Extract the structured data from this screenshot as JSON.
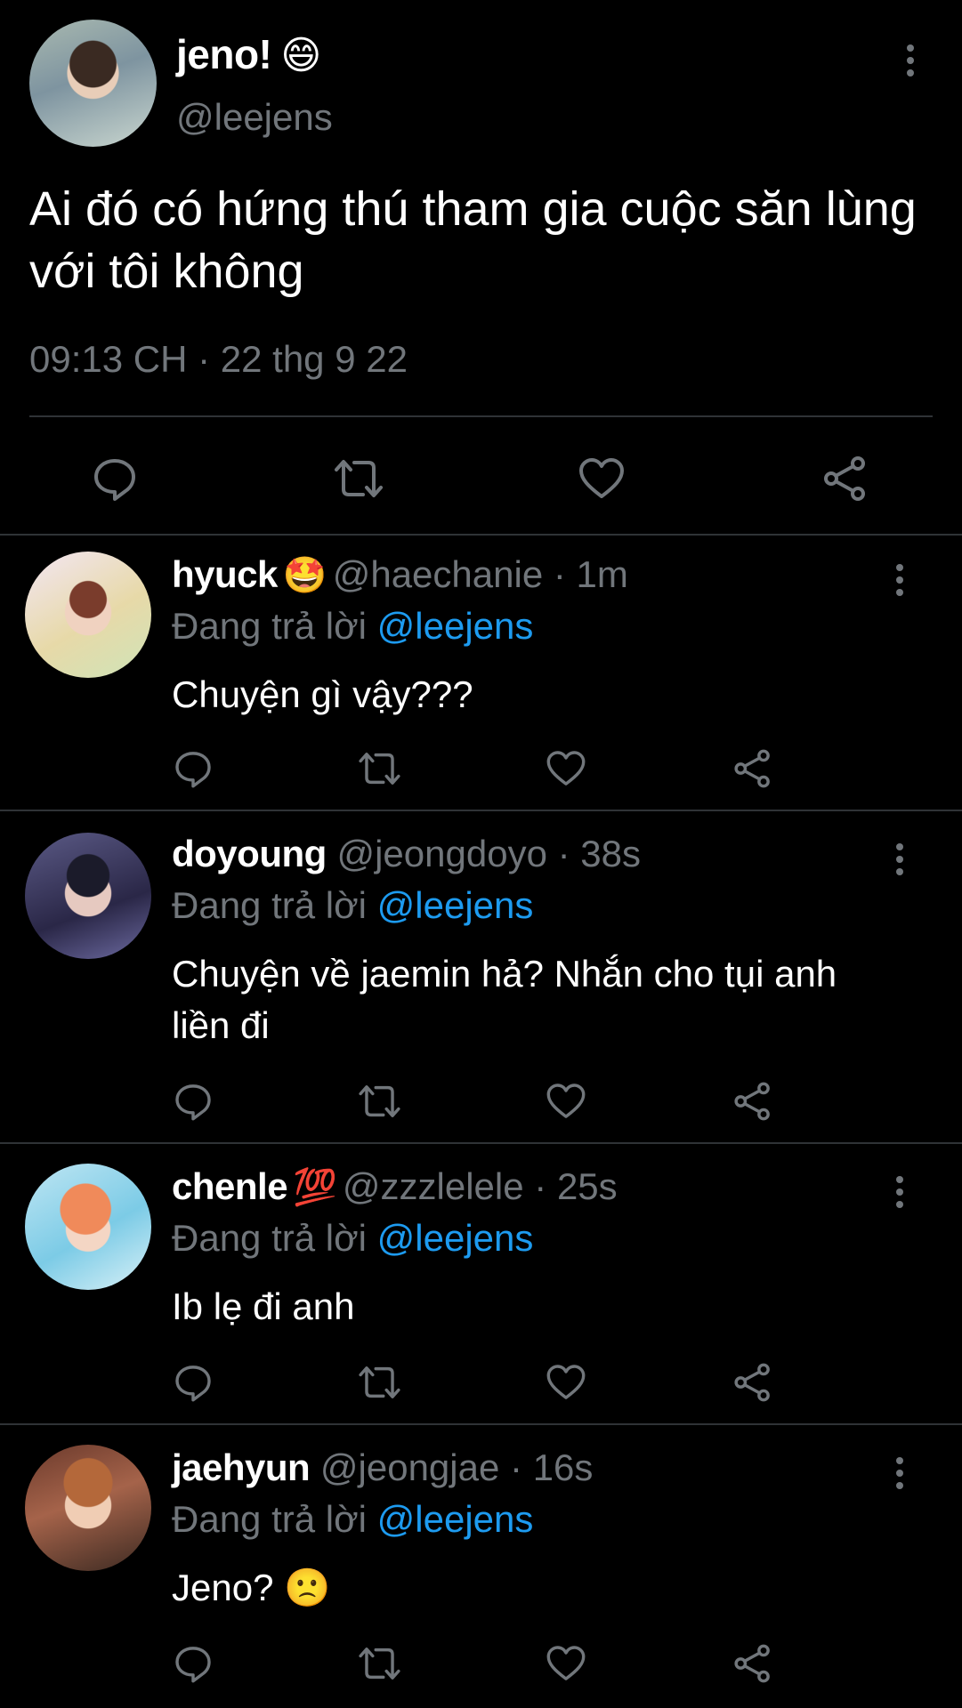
{
  "main_tweet": {
    "name": "jeno!",
    "emoji": "😄",
    "handle": "@leejens",
    "text": "Ai đó có hứng thú tham gia cuộc săn lùng với tôi không",
    "timestamp": "09:13 CH · 22 thg 9 22"
  },
  "replies": [
    {
      "name": "hyuck",
      "emoji": "🤩",
      "handle": "@haechanie",
      "dot": "·",
      "time": "1m",
      "replying_prefix": "Đang trả lời",
      "mention": "@leejens",
      "text": "Chuyện gì vậy???"
    },
    {
      "name": "doyoung",
      "emoji": "",
      "handle": "@jeongdoyo",
      "dot": "·",
      "time": "38s",
      "replying_prefix": "Đang trả lời",
      "mention": "@leejens",
      "text": "Chuyện về jaemin hả? Nhắn cho tụi anh liền đi"
    },
    {
      "name": "chenle",
      "emoji": "💯",
      "handle": "@zzzlelele",
      "dot": "·",
      "time": "25s",
      "replying_prefix": "Đang trả lời",
      "mention": "@leejens",
      "text": "Ib lẹ đi anh"
    },
    {
      "name": "jaehyun",
      "emoji": "",
      "handle": "@jeongjae",
      "dot": "·",
      "time": "16s",
      "replying_prefix": "Đang trả lời",
      "mention": "@leejens",
      "text": "Jeno? 🙁"
    }
  ],
  "colors": {
    "background": "#000000",
    "text": "#ffffff",
    "muted": "#71767b",
    "mention": "#1d9bf0",
    "divider": "#2f3336"
  },
  "icons": [
    "reply-icon",
    "retweet-icon",
    "like-icon",
    "share-icon",
    "more-icon"
  ]
}
